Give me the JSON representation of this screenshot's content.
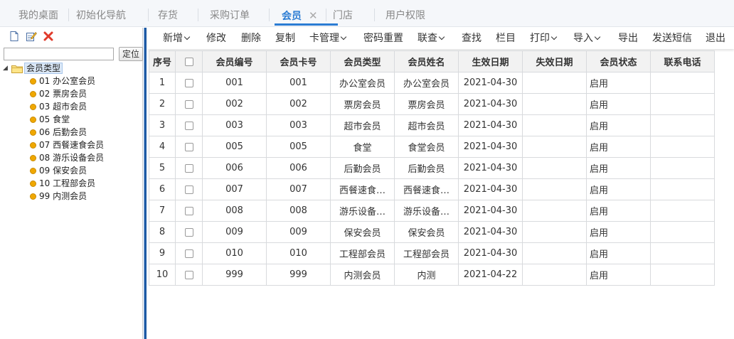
{
  "tabs": [
    {
      "label": "我的桌面",
      "active": false
    },
    {
      "label": "初始化导航",
      "active": false
    },
    {
      "label": "存货",
      "active": false
    },
    {
      "label": "采购订单",
      "active": false
    },
    {
      "label": "会员",
      "active": true,
      "close": "✕"
    },
    {
      "label": "门店",
      "active": false
    },
    {
      "label": "用户权限",
      "active": false
    }
  ],
  "left": {
    "search": {
      "value": "",
      "placeholder": ""
    },
    "locate_label": "定位",
    "tree": {
      "root_label": "会员类型",
      "items": [
        "01 办公室会员",
        "02 票房会员",
        "03 超市会员",
        "05 食堂",
        "06 后勤会员",
        "07 西餐速食会员",
        "08 游乐设备会员",
        "09 保安会员",
        "10 工程部会员",
        "99 内测会员"
      ]
    },
    "icons": [
      "new-file-icon",
      "edit-icon",
      "delete-icon"
    ]
  },
  "toolbar": [
    {
      "label": "新增",
      "dropdown": true
    },
    {
      "label": "修改",
      "dropdown": false
    },
    {
      "label": "删除",
      "dropdown": false
    },
    {
      "label": "复制",
      "dropdown": false
    },
    {
      "label": "卡管理",
      "dropdown": true
    },
    {
      "label": "密码重置",
      "dropdown": false
    },
    {
      "label": "联查",
      "dropdown": true
    },
    {
      "label": "查找",
      "dropdown": false
    },
    {
      "label": "栏目",
      "dropdown": false
    },
    {
      "label": "打印",
      "dropdown": true
    },
    {
      "label": "导入",
      "dropdown": true
    },
    {
      "label": "导出",
      "dropdown": false
    },
    {
      "label": "发送短信",
      "dropdown": false
    },
    {
      "label": "退出",
      "dropdown": false
    }
  ],
  "table": {
    "headers": [
      "序号",
      "",
      "会员编号",
      "会员卡号",
      "会员类型",
      "会员姓名",
      "生效日期",
      "失效日期",
      "会员状态",
      "联系电话"
    ],
    "rows": [
      [
        "1",
        "001",
        "001",
        "办公室会员",
        "办公室会员",
        "2021-04-30",
        "",
        "启用",
        ""
      ],
      [
        "2",
        "002",
        "002",
        "票房会员",
        "票房会员",
        "2021-04-30",
        "",
        "启用",
        ""
      ],
      [
        "3",
        "003",
        "003",
        "超市会员",
        "超市会员",
        "2021-04-30",
        "",
        "启用",
        ""
      ],
      [
        "4",
        "005",
        "005",
        "食堂",
        "食堂会员",
        "2021-04-30",
        "",
        "启用",
        ""
      ],
      [
        "5",
        "006",
        "006",
        "后勤会员",
        "后勤会员",
        "2021-04-30",
        "",
        "启用",
        ""
      ],
      [
        "6",
        "007",
        "007",
        "西餐速食…",
        "西餐速食…",
        "2021-04-30",
        "",
        "启用",
        ""
      ],
      [
        "7",
        "008",
        "008",
        "游乐设备…",
        "游乐设备…",
        "2021-04-30",
        "",
        "启用",
        ""
      ],
      [
        "8",
        "009",
        "009",
        "保安会员",
        "保安会员",
        "2021-04-30",
        "",
        "启用",
        ""
      ],
      [
        "9",
        "010",
        "010",
        "工程部会员",
        "工程部会员",
        "2021-04-30",
        "",
        "启用",
        ""
      ],
      [
        "10",
        "999",
        "999",
        "内测会员",
        "内测",
        "2021-04-22",
        "",
        "启用",
        ""
      ]
    ]
  },
  "colors": {
    "accent": "#2b7cd3",
    "splitter": "#1d5aa5",
    "tree_dot": "#f0a800"
  }
}
